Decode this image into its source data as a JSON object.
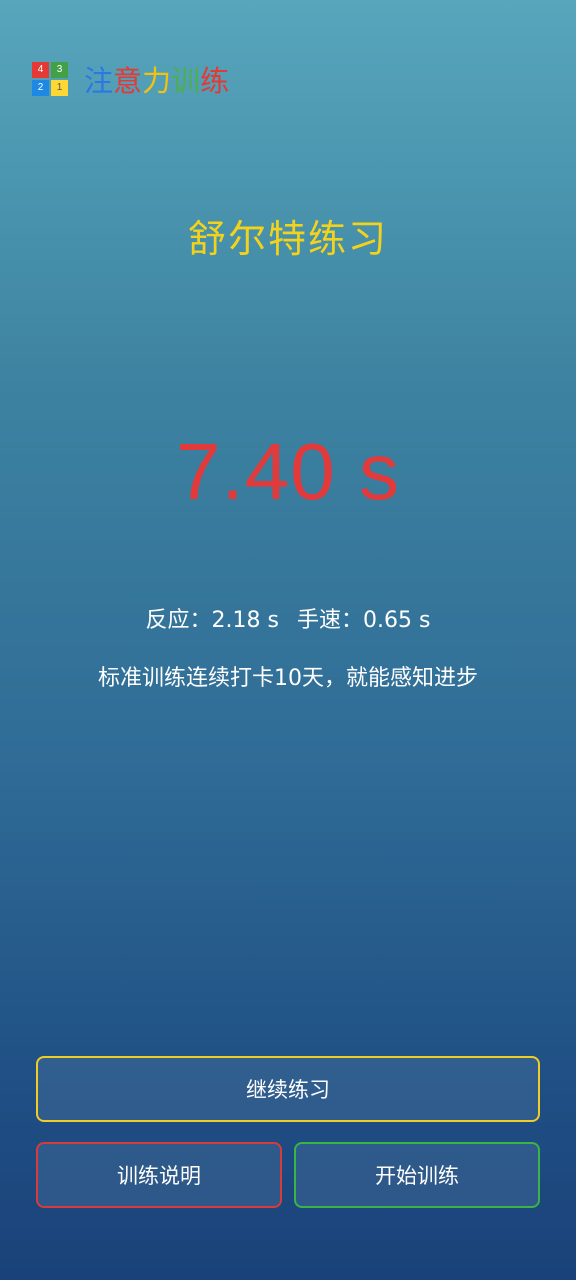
{
  "app": {
    "logo_cells": [
      {
        "label": "4",
        "color": "#e53935"
      },
      {
        "label": "3",
        "color": "#43a047"
      },
      {
        "label": "2",
        "color": "#1e88e5"
      },
      {
        "label": "1",
        "color": "#fdd835"
      }
    ],
    "title_chars": [
      {
        "char": "注",
        "color": "#2b78e4"
      },
      {
        "char": "意",
        "color": "#e53935"
      },
      {
        "char": "力",
        "color": "#f2c20f"
      },
      {
        "char": "训",
        "color": "#4caf50"
      },
      {
        "char": "练",
        "color": "#e53935"
      }
    ]
  },
  "mode": {
    "title": "舒尔特练习"
  },
  "result": {
    "total_time": "7.40 s",
    "reaction_label": "反应：2.18 s",
    "speed_label": "手速：0.65 s",
    "tip": "标准训练连续打卡10天，就能感知进步"
  },
  "buttons": {
    "continue_label": "继续练习",
    "help_label": "训练说明",
    "start_label": "开始训练"
  },
  "colors": {
    "accent_yellow": "#efcd25",
    "accent_red": "#d83a3d",
    "accent_green": "#39b34a",
    "time_red": "#e2393b"
  }
}
